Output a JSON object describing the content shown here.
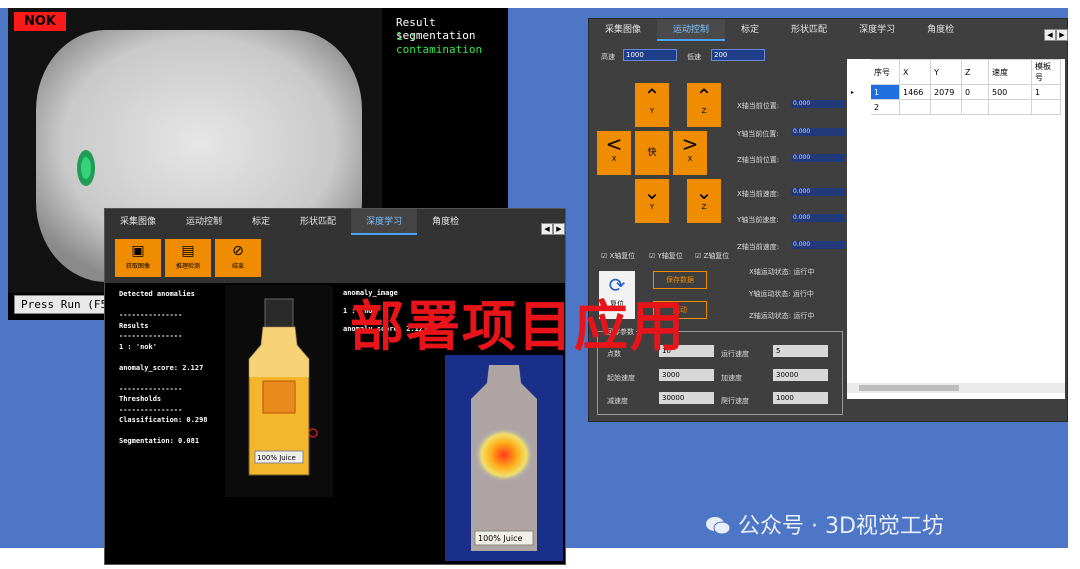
{
  "segmentation_window": {
    "status_label": "NOK",
    "result_title": "Result segmentation",
    "result_line": "1 : contamination",
    "run_button": "Press Run (F5)"
  },
  "motion_window": {
    "tabs": [
      "采集图像",
      "运动控制",
      "标定",
      "形状匹配",
      "深度学习",
      "角度检"
    ],
    "active_tab": 1,
    "high_speed_label": "高速",
    "high_speed_value": "1000",
    "low_speed_label": "低速",
    "low_speed_value": "200",
    "arrows": {
      "y_up": "Y",
      "z_up": "Z",
      "x_left": "X",
      "fast": "快",
      "x_right": "X",
      "y_down": "Y",
      "z_down": "Z"
    },
    "positions": [
      {
        "label": "X轴当前位置:",
        "value": "0.000"
      },
      {
        "label": "Y轴当前位置:",
        "value": "0.000"
      },
      {
        "label": "Z轴当前位置:",
        "value": "0.000"
      },
      {
        "label": "X轴当前速度:",
        "value": "0.000"
      },
      {
        "label": "Y轴当前速度:",
        "value": "0.000"
      },
      {
        "label": "Z轴当前速度:",
        "value": "0.000"
      }
    ],
    "checkboxes": [
      "X轴复位",
      "Y轴复位",
      "Z轴复位"
    ],
    "reset_label": "复位",
    "save_button": "保存数据",
    "run_button": "运动",
    "status_lines": [
      "X轴运动状态: 运行中",
      "Y轴运动状态: 运行中",
      "Z轴运动状态: 运行中"
    ],
    "group_title": "回零参数",
    "params": [
      {
        "label": "点数",
        "value": "10"
      },
      {
        "label": "运行速度",
        "value": "5"
      },
      {
        "label": "起始速度",
        "value": "3000"
      },
      {
        "label": "加速度",
        "value": "30000"
      },
      {
        "label": "减速度",
        "value": "30000"
      },
      {
        "label": "爬行速度",
        "value": "1000"
      }
    ],
    "grid": {
      "headers": [
        "序号",
        "X",
        "Y",
        "Z",
        "速度",
        "模板号"
      ],
      "rows": [
        [
          "1",
          "1466",
          "2079",
          "0",
          "500",
          "1"
        ],
        [
          "2",
          "",
          "",
          "",
          "",
          ""
        ]
      ]
    }
  },
  "dl_window": {
    "tabs": [
      "采集图像",
      "运动控制",
      "标定",
      "形状匹配",
      "深度学习",
      "角度检"
    ],
    "active_tab": 4,
    "toolbar": [
      "获取图像",
      "推理检测",
      "结束"
    ],
    "left_text": "Detected anomalies\n\n---------------\nResults\n---------------\n1 : 'nok'\n\nanomaly_score: 2.127\n\n---------------\nThresholds\n---------------\nClassification: 0.298\n\nSegmentation: 0.081",
    "right_text_1": "anomaly_image",
    "right_text_2": "1 : 'nok'",
    "right_text_3": "anomaly_score: 2.127",
    "bottle_label_1": "100% Juice",
    "bottle_label_2": "100% Juice"
  },
  "overlay_text": "部署项目应用",
  "watermark": "公众号 · 3D视觉工坊",
  "colors": {
    "background": "#4e76c6",
    "accent_orange": "#f08c00",
    "overlay_red": "#e8141a",
    "nok_red": "#ff1a1a",
    "segment_green": "#2ee84a"
  }
}
